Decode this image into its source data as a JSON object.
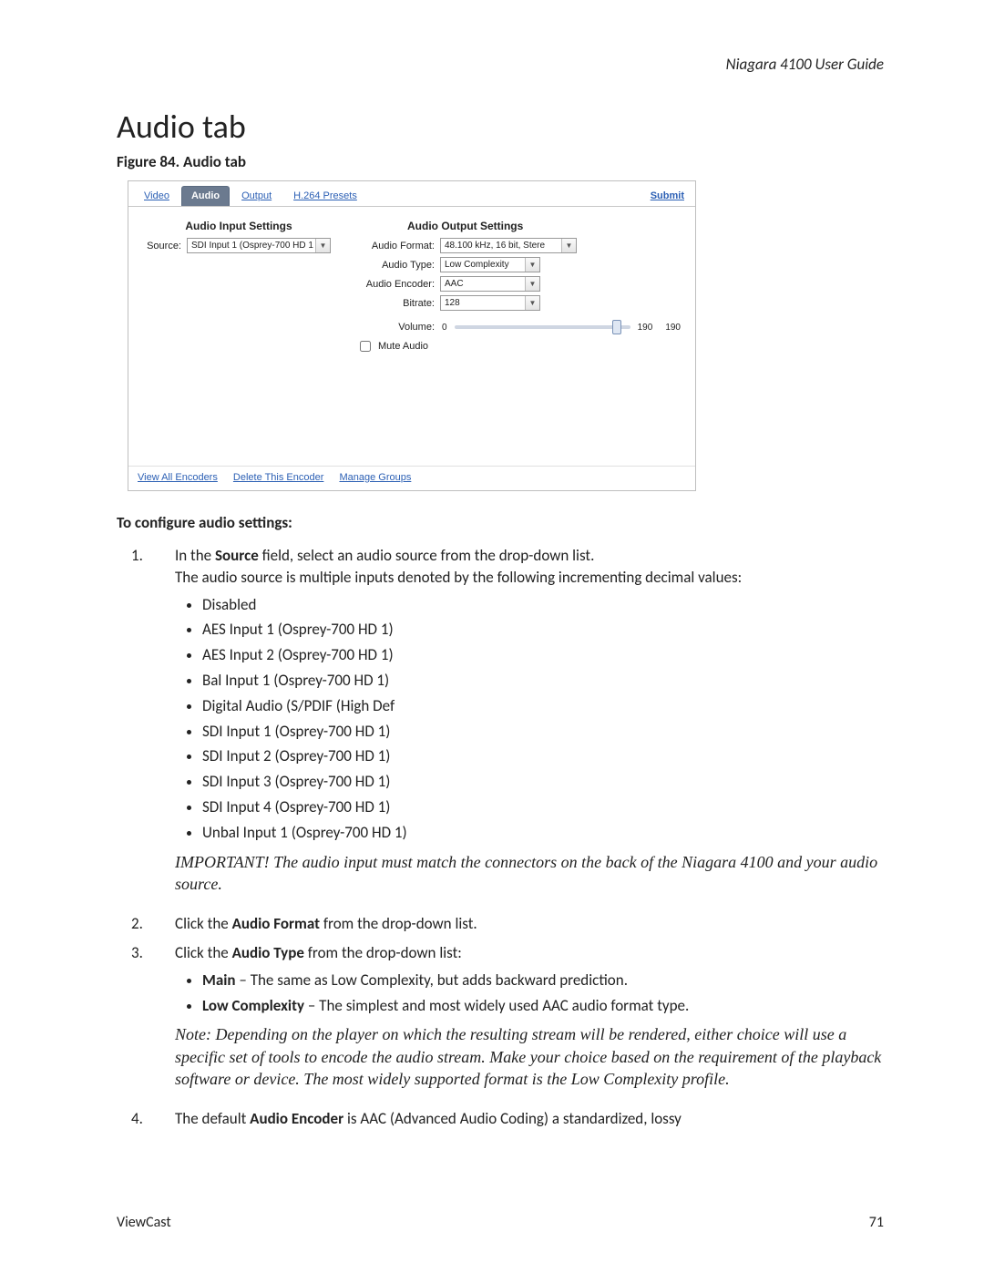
{
  "header": {
    "running": "Niagara 4100 User Guide"
  },
  "section": {
    "title": "Audio tab",
    "figure_caption": "Figure 84. Audio tab"
  },
  "figure": {
    "tabs": [
      "Video",
      "Audio",
      "Output",
      "H.264 Presets"
    ],
    "active_tab": 1,
    "submit": "Submit",
    "input_group": "Audio Input Settings",
    "source_label": "Source:",
    "source_value": "SDI Input 1 (Osprey-700 HD 1",
    "output_group": "Audio Output Settings",
    "fields": {
      "format_label": "Audio Format:",
      "format_value": "48.100 kHz, 16 bit, Stere",
      "type_label": "Audio Type:",
      "type_value": "Low Complexity",
      "encoder_label": "Audio Encoder:",
      "encoder_value": "AAC",
      "bitrate_label": "Bitrate:",
      "bitrate_value": "128",
      "volume_label": "Volume:",
      "volume_min": "0",
      "volume_near_max": "190",
      "volume_max": "190",
      "mute_label": "Mute Audio"
    },
    "footer_links": [
      "View All Encoders",
      "Delete This Encoder",
      "Manage Groups"
    ]
  },
  "body": {
    "heading": "To configure audio settings:",
    "step1_a": "In the ",
    "step1_b": "Source",
    "step1_c": " field, select an audio source from the drop-down list.",
    "step1_line2": "The audio source is multiple inputs denoted by the following incrementing decimal values:",
    "sources": [
      "Disabled",
      "AES Input 1 (Osprey-700 HD 1)",
      "AES Input 2 (Osprey-700 HD 1)",
      "Bal Input 1 (Osprey-700 HD 1)",
      "Digital Audio (S/PDIF (High Def",
      "SDI Input 1 (Osprey-700 HD 1)",
      "SDI Input 2 (Osprey-700 HD 1)",
      "SDI Input 3 (Osprey-700 HD 1)",
      "SDI Input 4 (Osprey-700 HD 1)",
      "Unbal Input 1 (Osprey-700 HD 1)"
    ],
    "important": "IMPORTANT! The audio input must match the connectors on the back of the Niagara 4100 and your audio source.",
    "step2_a": "Click the ",
    "step2_b": "Audio Format",
    "step2_c": " from the drop-down list.",
    "step3_a": "Click the ",
    "step3_b": "Audio Type",
    "step3_c": " from the drop-down list:",
    "type_main_b": "Main",
    "type_main_t": " – The same as Low Complexity, but adds backward prediction.",
    "type_low_b": "Low Complexity",
    "type_low_t": " – The simplest and most widely used AAC audio format type.",
    "note": "Note: Depending on the player on which the resulting stream will be rendered, either choice will use a specific set of tools to encode the audio stream. Make your choice based on the requirement of the playback software or device. The most widely supported format is the Low Complexity profile.",
    "step4_a": "The default ",
    "step4_b": "Audio Encoder",
    "step4_c": " is AAC (Advanced Audio Coding) a standardized, lossy"
  },
  "footer": {
    "left": "ViewCast",
    "right": "71"
  }
}
